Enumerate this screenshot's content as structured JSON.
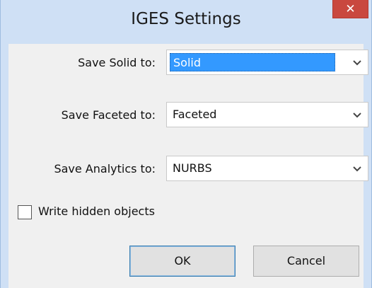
{
  "window": {
    "title": "IGES Settings",
    "close_glyph": "✕"
  },
  "fields": [
    {
      "label": "Save Solid to:",
      "value": "Solid",
      "selected": true
    },
    {
      "label": "Save Faceted to:",
      "value": "Faceted",
      "selected": false
    },
    {
      "label": "Save Analytics to:",
      "value": "NURBS",
      "selected": false
    }
  ],
  "checkbox": {
    "label": "Write hidden objects",
    "checked": false
  },
  "buttons": {
    "ok_label": "OK",
    "cancel_label": "Cancel"
  },
  "icons": {
    "dropdown": "chevron-down-icon",
    "close": "close-icon"
  },
  "colors": {
    "titlebar": "#cfe0f5",
    "client": "#f0f0f0",
    "close_button": "#c9483f",
    "selection": "#3399ff"
  }
}
